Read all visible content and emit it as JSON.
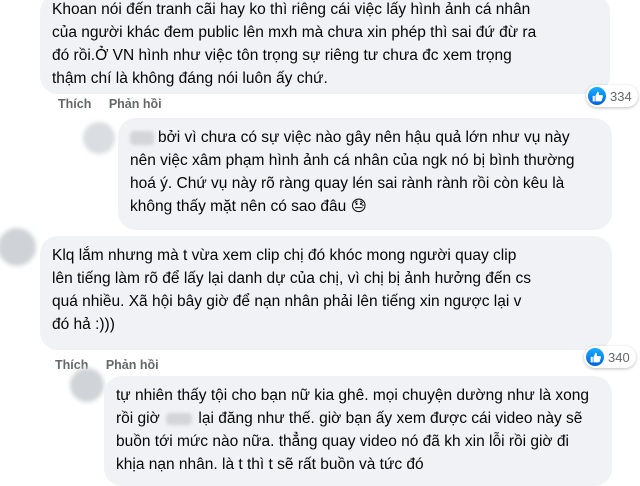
{
  "comments": [
    {
      "lines": [
        "Khoan nói đến tranh cãi hay ko thì riêng cái việc lấy hình ảnh cá nhân",
        "của người khác đem public lên mxh mà chưa xin phép thì sai đứ đừ ra",
        "đó rồi.Ở VN hình như việc tôn trọng sự riêng tư chưa đc xem trọng",
        "thậm chí là không đáng nói luôn ấy chứ."
      ],
      "like_label": "Thích",
      "reply_label": "Phản hồi",
      "reaction_count": "334"
    },
    {
      "lines": [
        "bởi vì chưa có sự việc nào gây nên hậu quả lớn như vụ này",
        "nên việc xâm phạm hình ảnh cá nhân của ngk nó bị bình thường",
        "hoá ý. Chứ vụ này rõ ràng quay lén sai rành rành rồi còn kêu là",
        "không thấy mặt nên có sao đâu 😓"
      ]
    },
    {
      "lines": [
        "Klq lắm nhưng mà t vừa xem clip chị đó khóc mong người quay clip",
        "lên tiếng làm rõ để lấy lại danh dự của chị, vì chị bị ảnh hưởng đến cs",
        "quá nhiều. Xã hội bây giờ để nạn nhân phải lên tiếng xin ngược lại v",
        "đó hả :)))"
      ],
      "like_label": "Thích",
      "reply_label": "Phản hồi",
      "reaction_count": "340"
    },
    {
      "lines": [
        "tự nhiên thấy tội cho bạn nữ kia ghê. mọi chuyện dường như là xong",
        "buồn tới mức nào nữa. thẳng quay video nó đã kh xin lỗi rồi giờ đi",
        "khịa nạn nhân. là t thì t sẽ rất buồn và tức đó"
      ],
      "line2_pre": "rồi giờ",
      "line2_post": "lại đăng như thế. giờ bạn ấy xem được cái video này sẽ"
    }
  ],
  "colors": {
    "bubble": "#f0f2f5",
    "action_text": "#65676b",
    "like_blue": "#0a7cff"
  }
}
